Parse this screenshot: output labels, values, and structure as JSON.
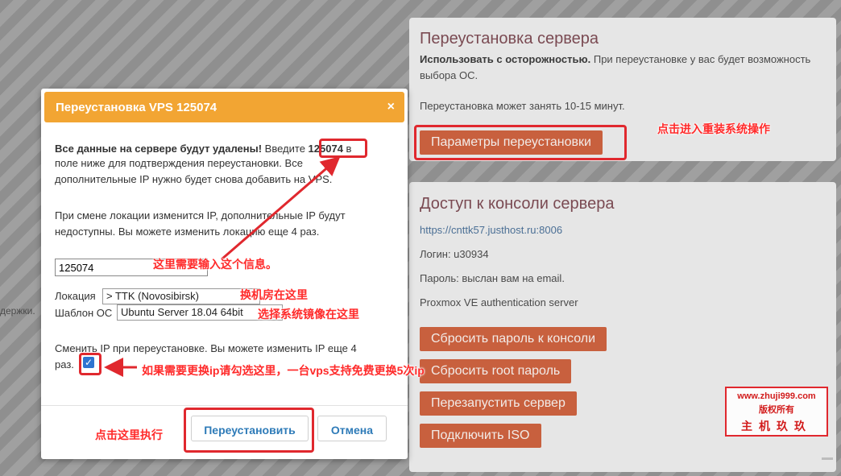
{
  "reinstall_panel": {
    "title": "Переустановка сервера",
    "warning_bold": "Использовать с осторожностью.",
    "warning_text": " При переустановке у вас будет возможность выбора ОС.",
    "duration": "Переустановка может занять 10-15 минут.",
    "params_button": "Параметры переустановки"
  },
  "console_panel": {
    "title": "Доступ к консоли сервера",
    "url": "https://cnttk57.justhost.ru:8006",
    "login": "Логин: u30934",
    "password": "Пароль: выслан вам на email.",
    "auth": "Proxmox VE authentication server",
    "buttons": [
      "Сбросить пароль к консоли",
      "Сбросить root пароль",
      "Перезапустить сервер",
      "Подключить ISO"
    ]
  },
  "side_text": "держки.",
  "modal": {
    "title": "Переустановка VPS 125074",
    "close": "×",
    "warning_bold": "Все данные на сервере будут удалены!",
    "warning_pre": " Введите ",
    "vps_id": "125074",
    "warning_line1_end": " в",
    "warning_line2": "поле ниже для подтверждения переустановки. Все",
    "warning_line3": "дополнительные IP нужно будет снова добавить на VPS.",
    "location_note_line1": "При смене локации изменится IP, дополнительные IP будут",
    "location_note_line2": "недоступны. Вы можете изменить локацию еще 4 раз.",
    "input_value": "125074",
    "location_label": "Локация",
    "location_value": "> TTK (Novosibirsk)",
    "os_label": "Шаблон ОС",
    "os_value": "Ubuntu Server 18.04 64bit",
    "ip_change_line1": "Сменить IP при переустановке. Вы можете изменить IP еще 4",
    "ip_change_line2": "раз.",
    "checkbox_mark": "✓",
    "reinstall_button": "Переустановить",
    "cancel_button": "Отмена"
  },
  "annotations": {
    "enter_reinstall": "点击进入重装系统操作",
    "enter_info": "这里需要输入这个信息。",
    "room_here": "换机房在这里",
    "image_here": "选择系统镜像在这里",
    "change_ip": "如果需要更换ip请勾选这里，一台vps支持免费更换5次ip",
    "click_execute": "点击这里执行"
  },
  "watermark": {
    "site": "www.zhuji999.com",
    "rights": "版权所有",
    "brand": "主机玖玖"
  },
  "colors": {
    "accent_orange": "#f2a533",
    "panel_button": "#c8603e",
    "annotation_red": "#e0282e"
  }
}
